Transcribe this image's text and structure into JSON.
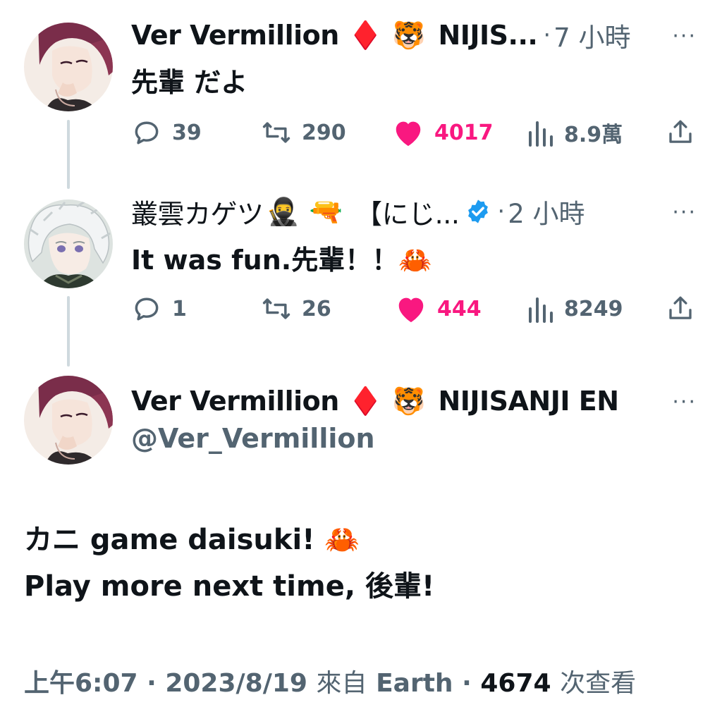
{
  "tweets": [
    {
      "author": "Ver Vermillion",
      "emoji1": "♦️",
      "emoji2": "🐯",
      "affiliation": "NIJIS...",
      "sep": "·",
      "time": "7 小時",
      "text": "先輩 だよ",
      "replies": "39",
      "retweets": "290",
      "likes": "4017",
      "views": "8.9萬"
    },
    {
      "author": "叢雲カゲツ",
      "emoji1": "🥷",
      "emoji2": "🔫",
      "affiliation": "【にじ...",
      "sep": "·",
      "time": "2 小時",
      "text": "It was fun.先輩！！🦀",
      "replies": "1",
      "retweets": "26",
      "likes": "444",
      "views": "8249",
      "verified": true
    }
  ],
  "main_tweet": {
    "author": "Ver Vermillion",
    "emoji1": "♦️",
    "emoji2": "🐯",
    "affiliation": "NIJISANJI EN",
    "handle": "@Ver_Vermillion",
    "line1": "カニ game daisuki! 🦀",
    "line2": "Play more next time, 後輩!",
    "time": "上午6:07",
    "date": "2023/8/19",
    "source_prefix": "來自",
    "source": "Earth",
    "views": "4674",
    "views_label": "次查看",
    "sep": "·"
  },
  "more_label": "···",
  "colors": {
    "like": "#f91880",
    "muted": "#536471",
    "text": "#0f1419",
    "verified": "#1d9bf0",
    "thread_line": "#cfd9de"
  }
}
